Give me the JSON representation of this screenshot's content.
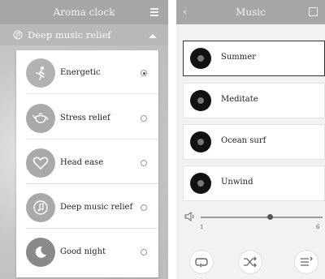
{
  "left": {
    "title": "Aroma clock",
    "sub_label": "Deep music relief",
    "menu": [
      {
        "label": "Energetic",
        "icon": "runner-icon",
        "selected": true
      },
      {
        "label": "Stress relief",
        "icon": "teapot-icon",
        "selected": false
      },
      {
        "label": "Head ease",
        "icon": "heart-icon",
        "selected": false
      },
      {
        "label": "Deep music relief",
        "icon": "music-note-icon",
        "selected": false
      },
      {
        "label": "Good night",
        "icon": "moon-icon",
        "selected": false
      }
    ]
  },
  "right": {
    "title": "Music",
    "tracks": [
      {
        "name": "Summer",
        "active": true
      },
      {
        "name": "Meditate",
        "active": false
      },
      {
        "name": "Ocean surf",
        "active": false
      },
      {
        "name": "Unwind",
        "active": false
      }
    ],
    "volume": {
      "min": "1",
      "max": "6",
      "level_fraction": 0.57
    }
  },
  "colors": {
    "topbar": "#a6a6a6",
    "menu_circle": "#a9a9a9",
    "selected_circle": "#b2b2b2"
  }
}
